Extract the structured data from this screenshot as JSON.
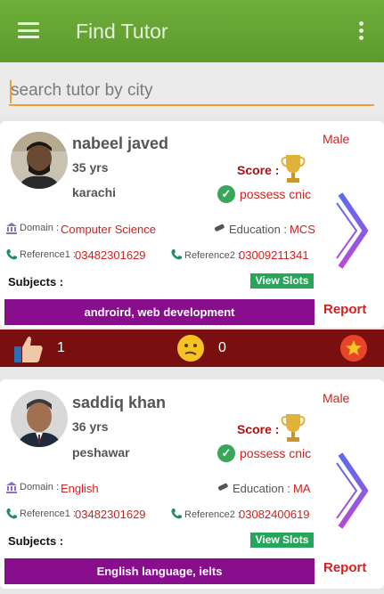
{
  "appbar": {
    "title": "Find Tutor",
    "menu_icon": "hamburger-menu-icon",
    "overflow_icon": "more-vertical-icon"
  },
  "search": {
    "placeholder": "search tutor by city",
    "value": ""
  },
  "colors": {
    "appbar": "#6fae3a",
    "accent": "#d32020",
    "subjects_bar": "#880e8e",
    "view_slots": "#26a65b",
    "rating_bar": "#7a0f0f"
  },
  "tutors": [
    {
      "name": "nabeel javed",
      "age": "35 yrs",
      "city": "karachi",
      "gender": "Male",
      "score_label": "Score :",
      "cnic": "possess cnic",
      "domain_label": "Domain :",
      "domain": "Computer Science",
      "education_label": "Education :",
      "education": "MCS",
      "reference1_label": "Reference1 :",
      "reference1": "03482301629",
      "reference2_label": "Reference2 :",
      "reference2": "03009211341",
      "subjects_label": "Subjects :",
      "view_slots": "View Slots",
      "subjects": "androird, web development",
      "report": "Report"
    },
    {
      "name": "saddiq khan",
      "age": "36 yrs",
      "city": "peshawar",
      "gender": "Male",
      "score_label": "Score :",
      "cnic": "possess cnic",
      "domain_label": "Domain :",
      "domain": "English",
      "education_label": "Education :",
      "education": "MA",
      "reference1_label": "Reference1 :",
      "reference1": "03482301629",
      "reference2_label": "Reference2 :",
      "reference2": "03082400619",
      "subjects_label": "Subjects :",
      "view_slots": "View Slots",
      "subjects": "English language, ielts",
      "report": "Report"
    }
  ],
  "rating": {
    "likes": "1",
    "neutral": "0",
    "like_icon": "thumbs-up-icon",
    "neutral_icon": "confused-face-icon",
    "favorite_icon": "star-icon"
  }
}
